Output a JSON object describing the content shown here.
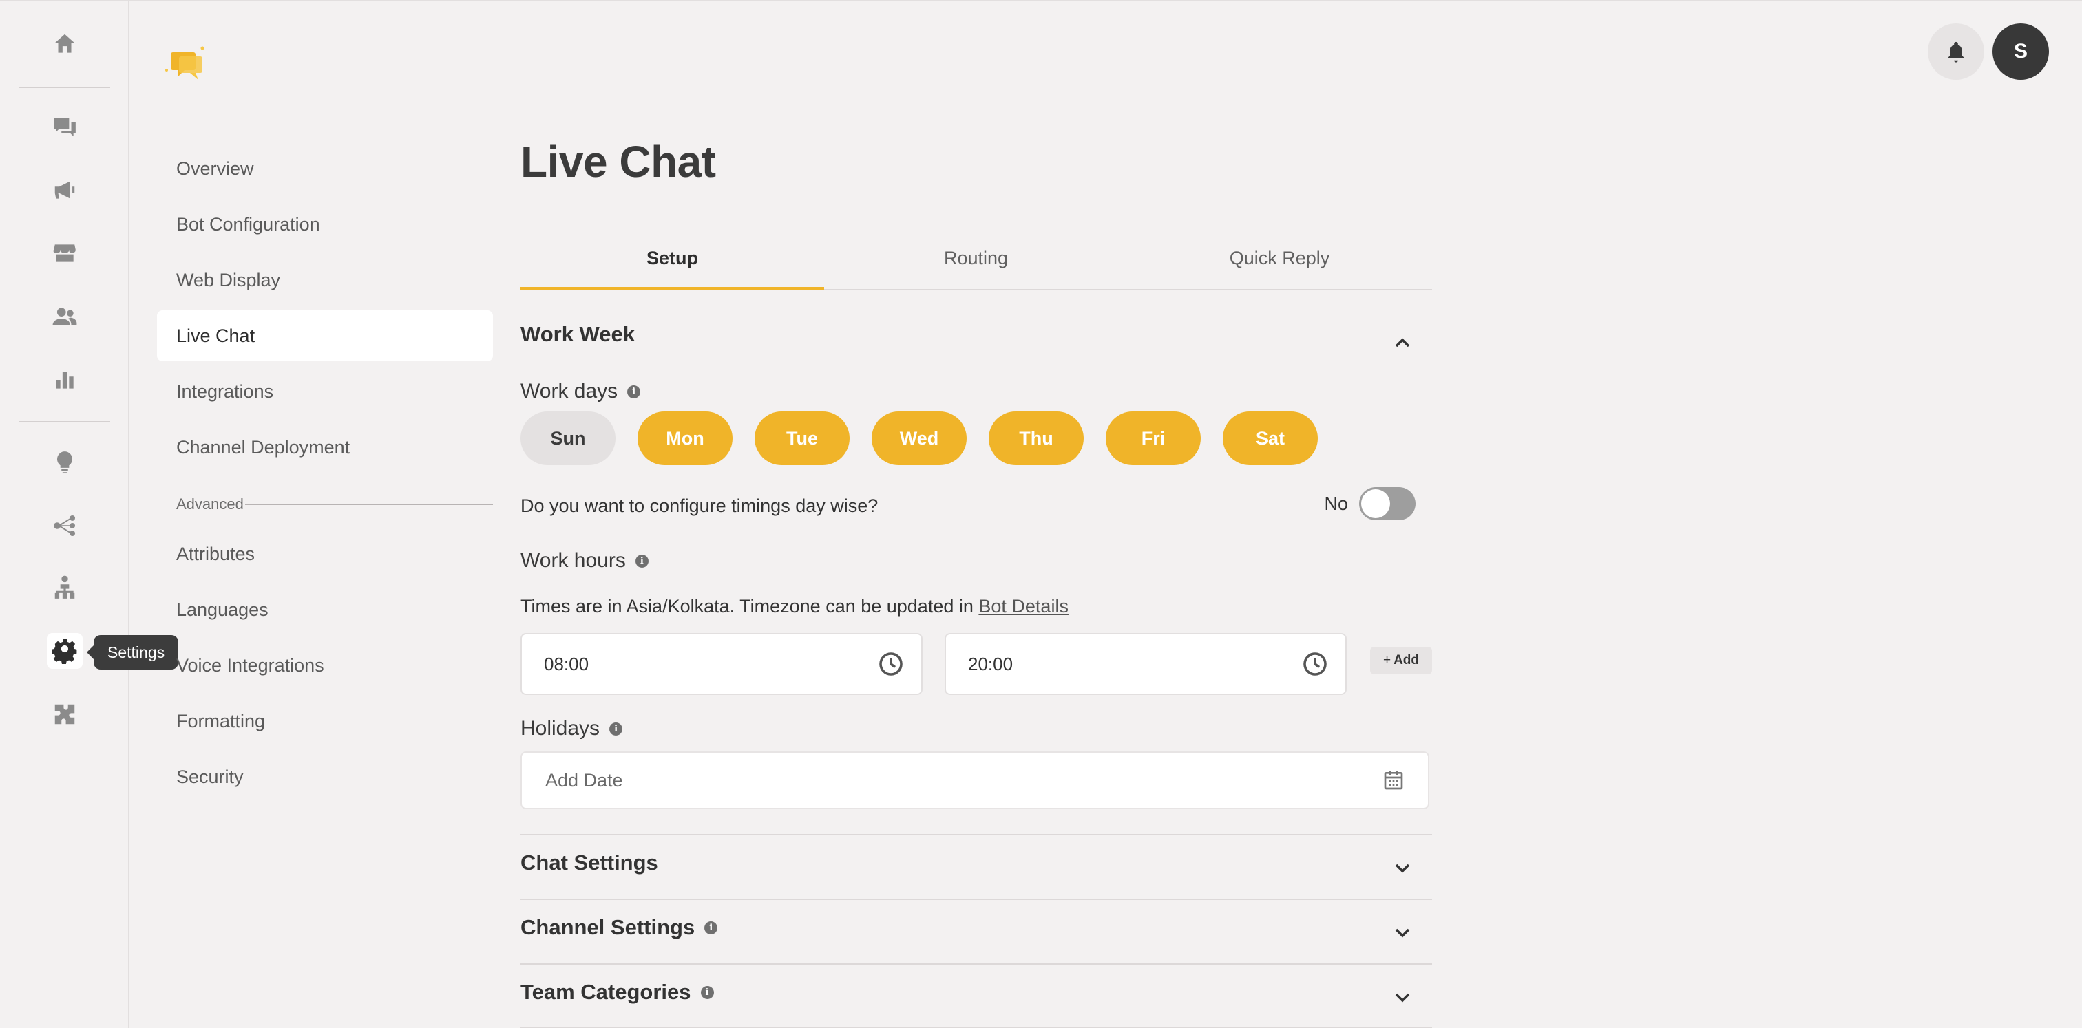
{
  "sidebar_tooltip": "Settings",
  "user_initial": "S",
  "subnav": {
    "items": [
      "Overview",
      "Bot Configuration",
      "Web Display",
      "Live Chat",
      "Integrations",
      "Channel Deployment"
    ],
    "active": "Live Chat",
    "section_label": "Advanced",
    "advanced_items": [
      "Attributes",
      "Languages",
      "Voice Integrations",
      "Formatting",
      "Security"
    ]
  },
  "page": {
    "title": "Live Chat",
    "tabs": [
      "Setup",
      "Routing",
      "Quick Reply"
    ],
    "active_tab": "Setup"
  },
  "work_week": {
    "title": "Work Week",
    "work_days_label": "Work days",
    "days": [
      {
        "label": "Sun",
        "selected": false
      },
      {
        "label": "Mon",
        "selected": true
      },
      {
        "label": "Tue",
        "selected": true
      },
      {
        "label": "Wed",
        "selected": true
      },
      {
        "label": "Thu",
        "selected": true
      },
      {
        "label": "Fri",
        "selected": true
      },
      {
        "label": "Sat",
        "selected": true
      }
    ],
    "daywise_question": "Do you want to configure timings day wise?",
    "daywise_value": "No",
    "work_hours_label": "Work hours",
    "timezone_text": "Times are in Asia/Kolkata. Timezone can be updated in ",
    "timezone_link": "Bot Details",
    "start_time": "08:00",
    "end_time": "20:00",
    "add_label": "Add",
    "holidays_label": "Holidays",
    "add_date_placeholder": "Add Date"
  },
  "sections": {
    "chat_settings": "Chat Settings",
    "channel_settings": "Channel Settings",
    "team_categories": "Team Categories"
  },
  "colors": {
    "accent": "#f0b429",
    "background": "#f3f1f1"
  },
  "icons": [
    "home-icon",
    "chat-icon",
    "megaphone-icon",
    "store-icon",
    "users-icon",
    "bar-chart-icon",
    "lightbulb-icon",
    "flow-icon",
    "hierarchy-icon",
    "gear-icon",
    "puzzle-icon",
    "bell-icon",
    "clock-icon",
    "calendar-icon",
    "chevron-up-icon",
    "chevron-down-icon",
    "info-icon"
  ]
}
